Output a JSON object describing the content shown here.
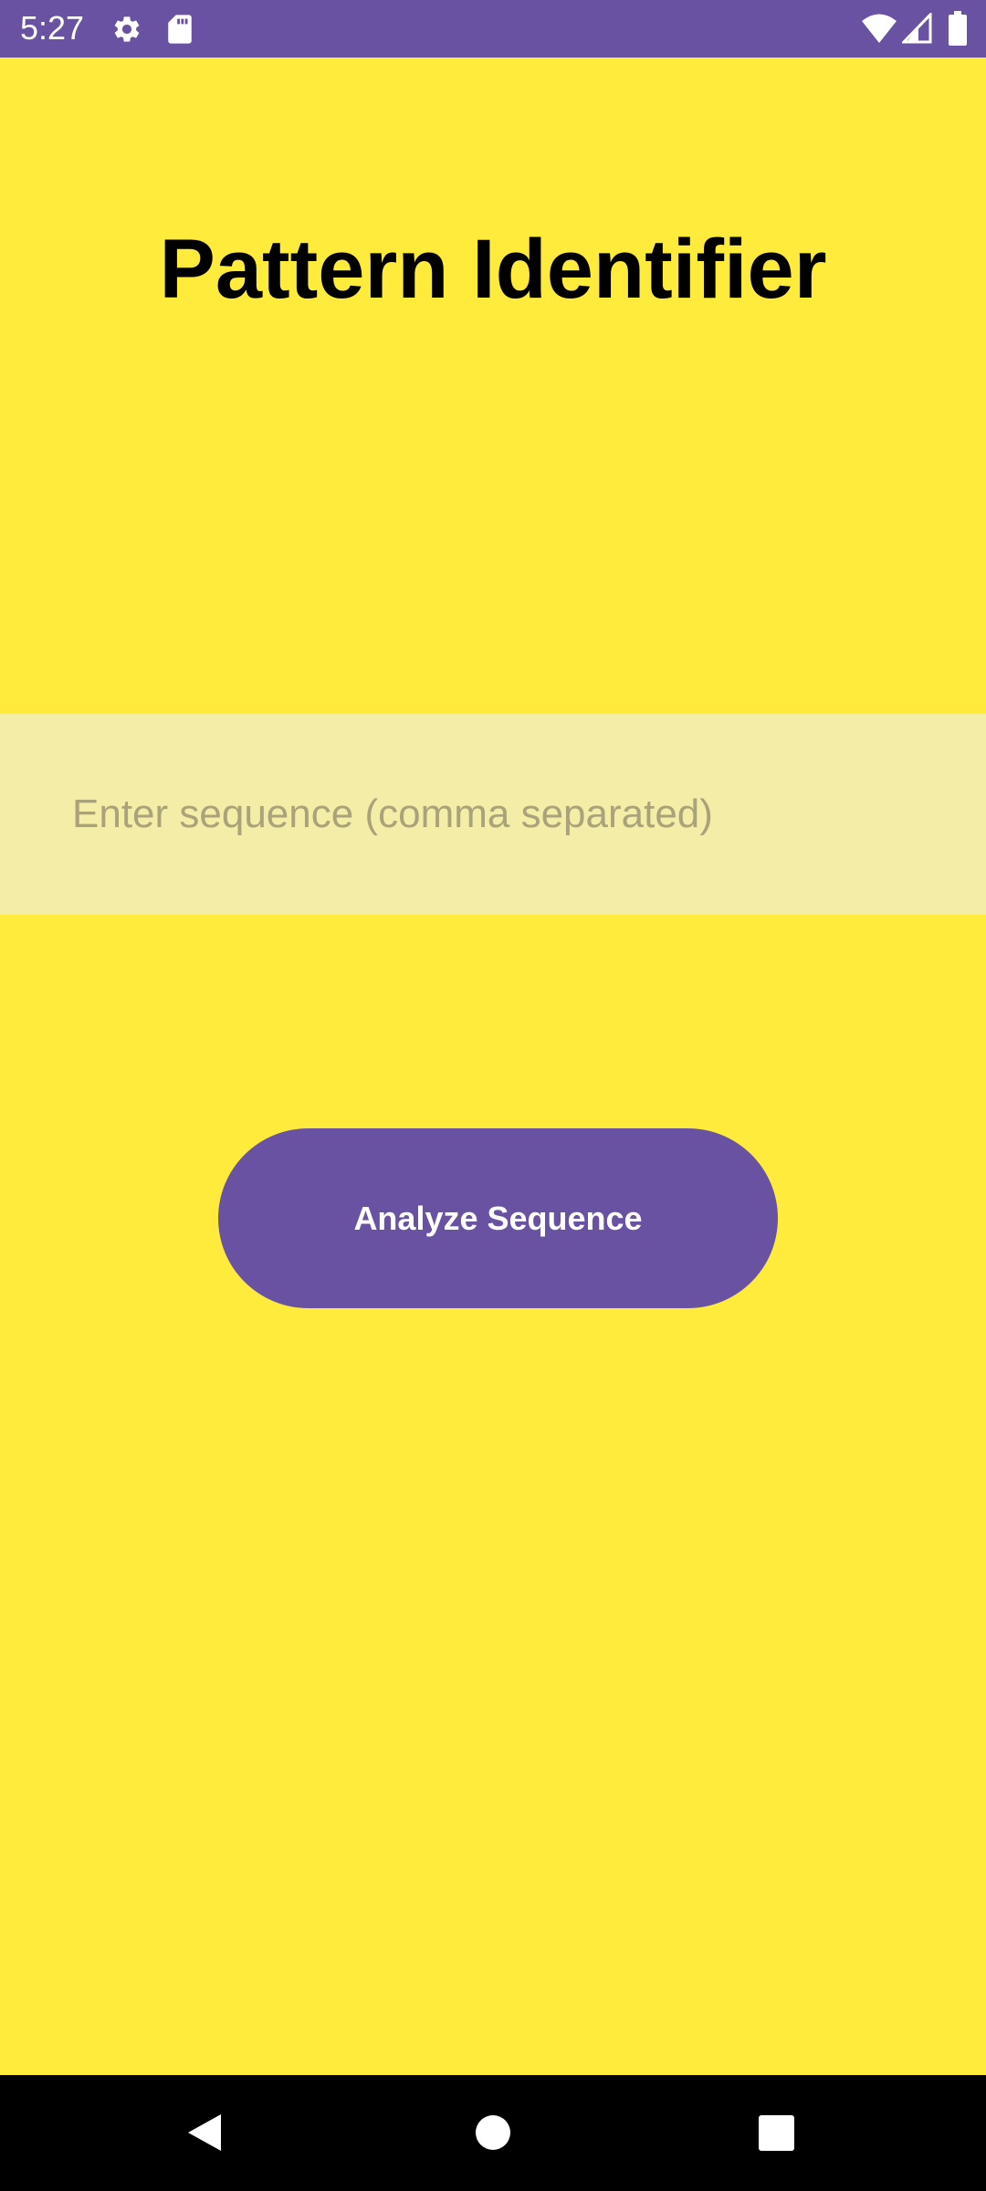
{
  "status_bar": {
    "time": "5:27",
    "background_color": "#6A52A3",
    "icons": [
      "settings-gear-icon",
      "sd-card-icon",
      "wifi-icon",
      "cell-signal-icon",
      "battery-icon"
    ]
  },
  "app": {
    "background_color": "#FFEB3B",
    "title": "Pattern Identifier",
    "sequence_input": {
      "value": "",
      "placeholder": "Enter sequence (comma separated)",
      "background_color": "#F3EDA7"
    },
    "analyze_button": {
      "label": "Analyze Sequence",
      "color": "#6A52A3"
    }
  },
  "nav_bar": {
    "buttons": [
      "back-icon",
      "home-icon",
      "recents-icon"
    ]
  }
}
